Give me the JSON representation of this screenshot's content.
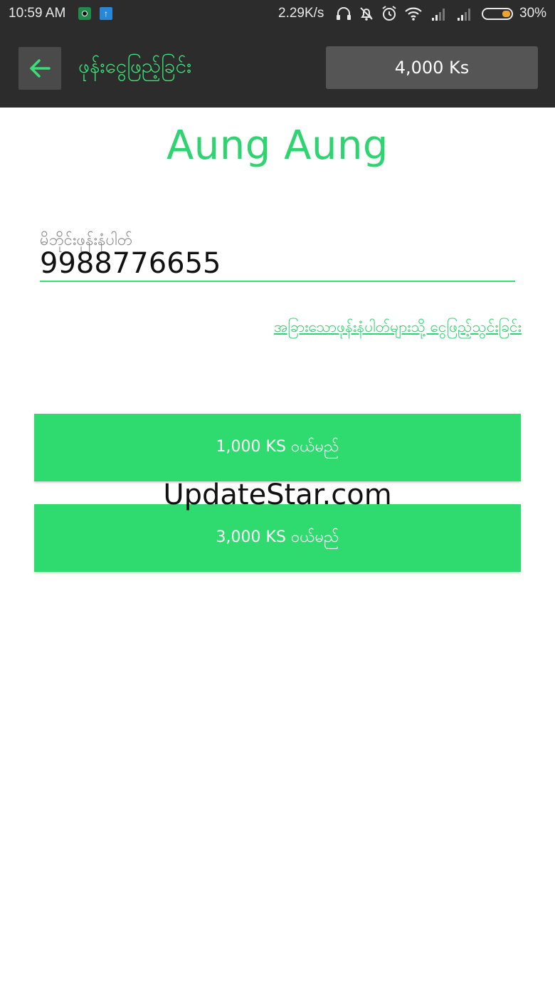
{
  "status_bar": {
    "time": "10:59 AM",
    "net_speed": "2.29K/s",
    "battery_percent": "30%",
    "battery_level": 0.3,
    "icons": [
      "app-notification-icon",
      "upload-icon",
      "headset-icon",
      "muted-bell-icon",
      "alarm-icon",
      "wifi-icon",
      "signal-icon",
      "signal-icon",
      "battery-icon"
    ]
  },
  "header": {
    "back_icon": "arrow-left-icon",
    "title": "ဖုန်းငွေဖြည့်ခြင်း",
    "balance": "4,000 Ks"
  },
  "main": {
    "recipient_name": "Aung Aung",
    "phone_label": "မိဘိုင်းဖုန်းနံပါတ်",
    "phone_value": "9988776655",
    "other_numbers_link": "အခြားသောဖုန်းနံပါတ်များသို့ ငွေဖြည့်သွင်းခြင်း",
    "buttons": [
      {
        "label": "1,000 KS ဝယ်မည်"
      },
      {
        "label": "3,000 KS ဝယ်မည်"
      }
    ]
  },
  "watermark": "UpdateStar.com",
  "colors": {
    "accent": "#2fdb6e",
    "bar_background": "#2c2c2c",
    "balance_background": "#555555"
  }
}
